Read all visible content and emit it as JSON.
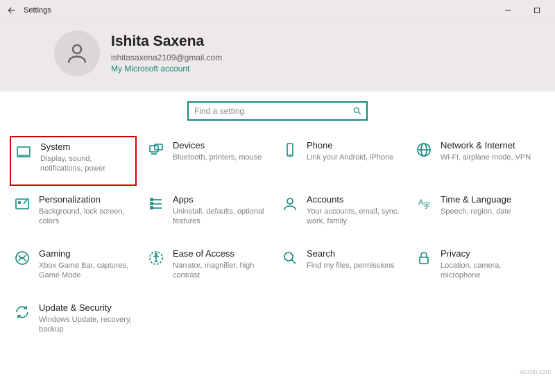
{
  "window": {
    "title": "Settings"
  },
  "user": {
    "name": "Ishita Saxena",
    "email": "ishitasaxena2109@gmail.com",
    "msaccount": "My Microsoft account"
  },
  "search": {
    "placeholder": "Find a setting"
  },
  "tiles": {
    "system": {
      "title": "System",
      "desc": "Display, sound, notifications, power"
    },
    "devices": {
      "title": "Devices",
      "desc": "Bluetooth, printers, mouse"
    },
    "phone": {
      "title": "Phone",
      "desc": "Link your Android, iPhone"
    },
    "network": {
      "title": "Network & Internet",
      "desc": "Wi-Fi, airplane mode, VPN"
    },
    "personalization": {
      "title": "Personalization",
      "desc": "Background, lock screen, colors"
    },
    "apps": {
      "title": "Apps",
      "desc": "Uninstall, defaults, optional features"
    },
    "accounts": {
      "title": "Accounts",
      "desc": "Your accounts, email, sync, work, family"
    },
    "time": {
      "title": "Time & Language",
      "desc": "Speech, region, date"
    },
    "gaming": {
      "title": "Gaming",
      "desc": "Xbox Game Bar, captures, Game Mode"
    },
    "ease": {
      "title": "Ease of Access",
      "desc": "Narrator, magnifier, high contrast"
    },
    "search_tile": {
      "title": "Search",
      "desc": "Find my files, permissions"
    },
    "privacy": {
      "title": "Privacy",
      "desc": "Location, camera, microphone"
    },
    "update": {
      "title": "Update & Security",
      "desc": "Windows Update, recovery, backup"
    }
  },
  "watermark": "wsxdn.com"
}
